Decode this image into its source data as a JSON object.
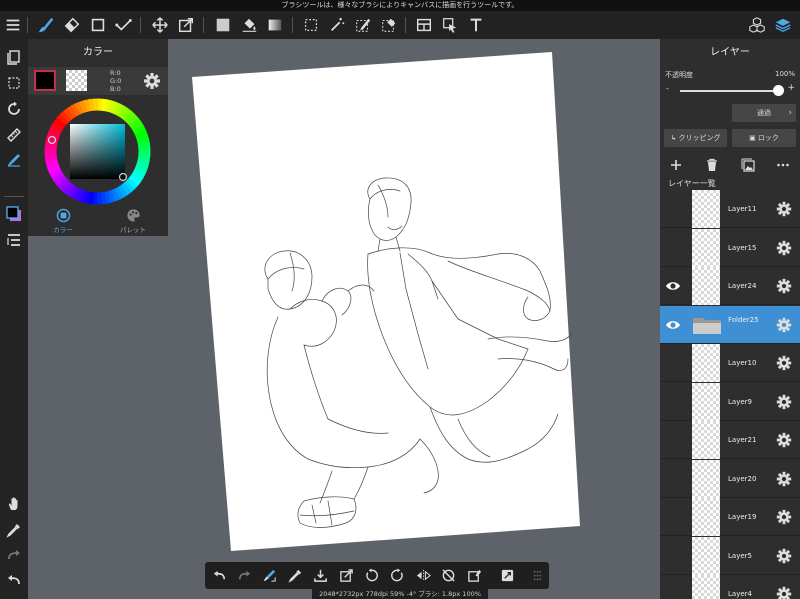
{
  "hint": "ブラシツールは、様々なブラシによりキャンバスに描画を行うツールです。",
  "color_panel": {
    "title": "カラー",
    "main_color": "#000000",
    "rgb": {
      "r": "R:0",
      "g": "G:0",
      "b": "B:0"
    },
    "tabs": [
      {
        "label": "カラー",
        "active": true
      },
      {
        "label": "パレット",
        "active": false
      }
    ]
  },
  "layer_panel": {
    "title": "レイヤー",
    "opacity_label": "不透明度",
    "opacity_value": "100%",
    "opacity_fraction": 1.0,
    "minus": "-",
    "plus": "+",
    "blend_mode": "通過",
    "clipping_label": "クリッピング",
    "lock_label": "ロック",
    "list_header": "レイヤー一覧",
    "layers": [
      {
        "name": "Layer11",
        "visible": false,
        "selected": false,
        "type": "layer"
      },
      {
        "name": "Layer15",
        "visible": false,
        "selected": false,
        "type": "layer"
      },
      {
        "name": "Layer24",
        "visible": true,
        "selected": false,
        "type": "layer"
      },
      {
        "name": "Folder25",
        "visible": true,
        "selected": true,
        "type": "folder"
      },
      {
        "name": "Layer10",
        "visible": false,
        "selected": false,
        "type": "layer"
      },
      {
        "name": "Layer9",
        "visible": false,
        "selected": false,
        "type": "layer"
      },
      {
        "name": "Layer21",
        "visible": false,
        "selected": false,
        "type": "layer"
      },
      {
        "name": "Layer20",
        "visible": false,
        "selected": false,
        "type": "layer"
      },
      {
        "name": "Layer19",
        "visible": false,
        "selected": false,
        "type": "layer"
      },
      {
        "name": "Layer5",
        "visible": false,
        "selected": false,
        "type": "layer"
      },
      {
        "name": "Layer4",
        "visible": false,
        "selected": false,
        "type": "layer"
      }
    ]
  },
  "status": "2048*2732px 778dpi 59% -4° ブラシ: 1.8px 100%",
  "colors": {
    "accent": "#3e8fd4",
    "canvas_bg": "#5e6369",
    "panel_bg": "#2e2e2e",
    "toolbar_bg": "#222222",
    "main_swatch_border": "#c4304c"
  },
  "icons": {
    "top_toolbar": [
      "menu-icon",
      "brush-icon",
      "eraser-icon",
      "rectangle-icon",
      "line-icon",
      "move-icon",
      "transform-icon",
      "fill-color-icon",
      "bucket-icon",
      "gradient-icon",
      "select-rect-icon",
      "magic-wand-icon",
      "select-pen-icon",
      "select-eraser-icon",
      "layout-icon",
      "select-arrow-icon",
      "text-icon",
      "materials-icon",
      "layers-icon"
    ],
    "left_toolbar": [
      "layers-icon",
      "selection-icon",
      "rotate-icon",
      "ruler-icon",
      "pen-settings-icon",
      "color-icon",
      "layer-list-icon",
      "hand-icon",
      "eyedropper-icon",
      "redo-icon",
      "undo-icon"
    ],
    "bottom_toolbar": [
      "undo-icon",
      "redo-icon",
      "brush-dropper-icon",
      "eyedropper-icon",
      "import-icon",
      "transform-icon",
      "rotate-left-icon",
      "rotate-right-icon",
      "flip-icon",
      "rotate-reset-icon",
      "clear-icon",
      "fullscreen-icon",
      "grip-icon"
    ]
  }
}
